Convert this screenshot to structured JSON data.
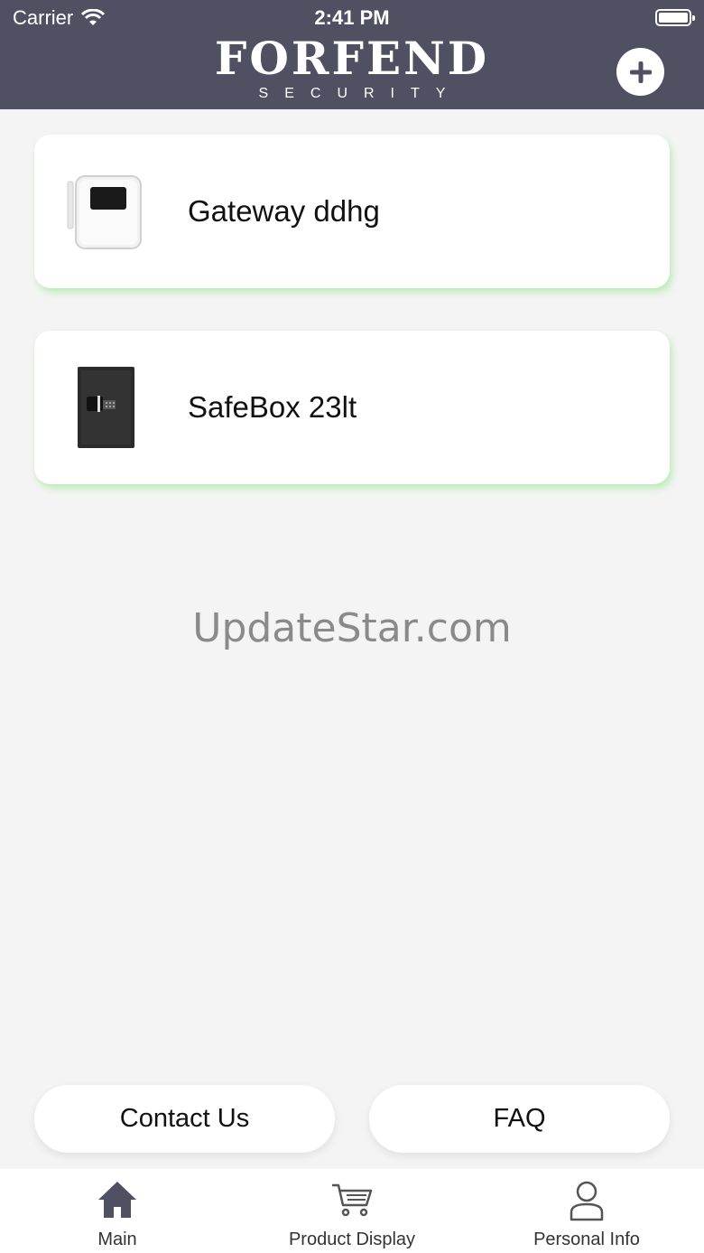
{
  "status_bar": {
    "carrier": "Carrier",
    "time": "2:41 PM"
  },
  "header": {
    "logo_main": "FORFEND",
    "logo_sub": "SECURITY",
    "add_icon": "plus-circle-icon"
  },
  "devices": [
    {
      "name": "Gateway ddhg",
      "icon": "gateway-device-image"
    },
    {
      "name": "SafeBox 23lt",
      "icon": "safe-box-image"
    }
  ],
  "watermark": "UpdateStar.com",
  "buttons": {
    "contact": "Contact Us",
    "faq": "FAQ"
  },
  "tabs": [
    {
      "label": "Main",
      "icon": "home-icon"
    },
    {
      "label": "Product Display",
      "icon": "cart-icon"
    },
    {
      "label": "Personal Info",
      "icon": "person-icon"
    }
  ],
  "colors": {
    "header": "#4f5163",
    "card_glow": "#96e68c",
    "background": "#f4f4f4"
  }
}
